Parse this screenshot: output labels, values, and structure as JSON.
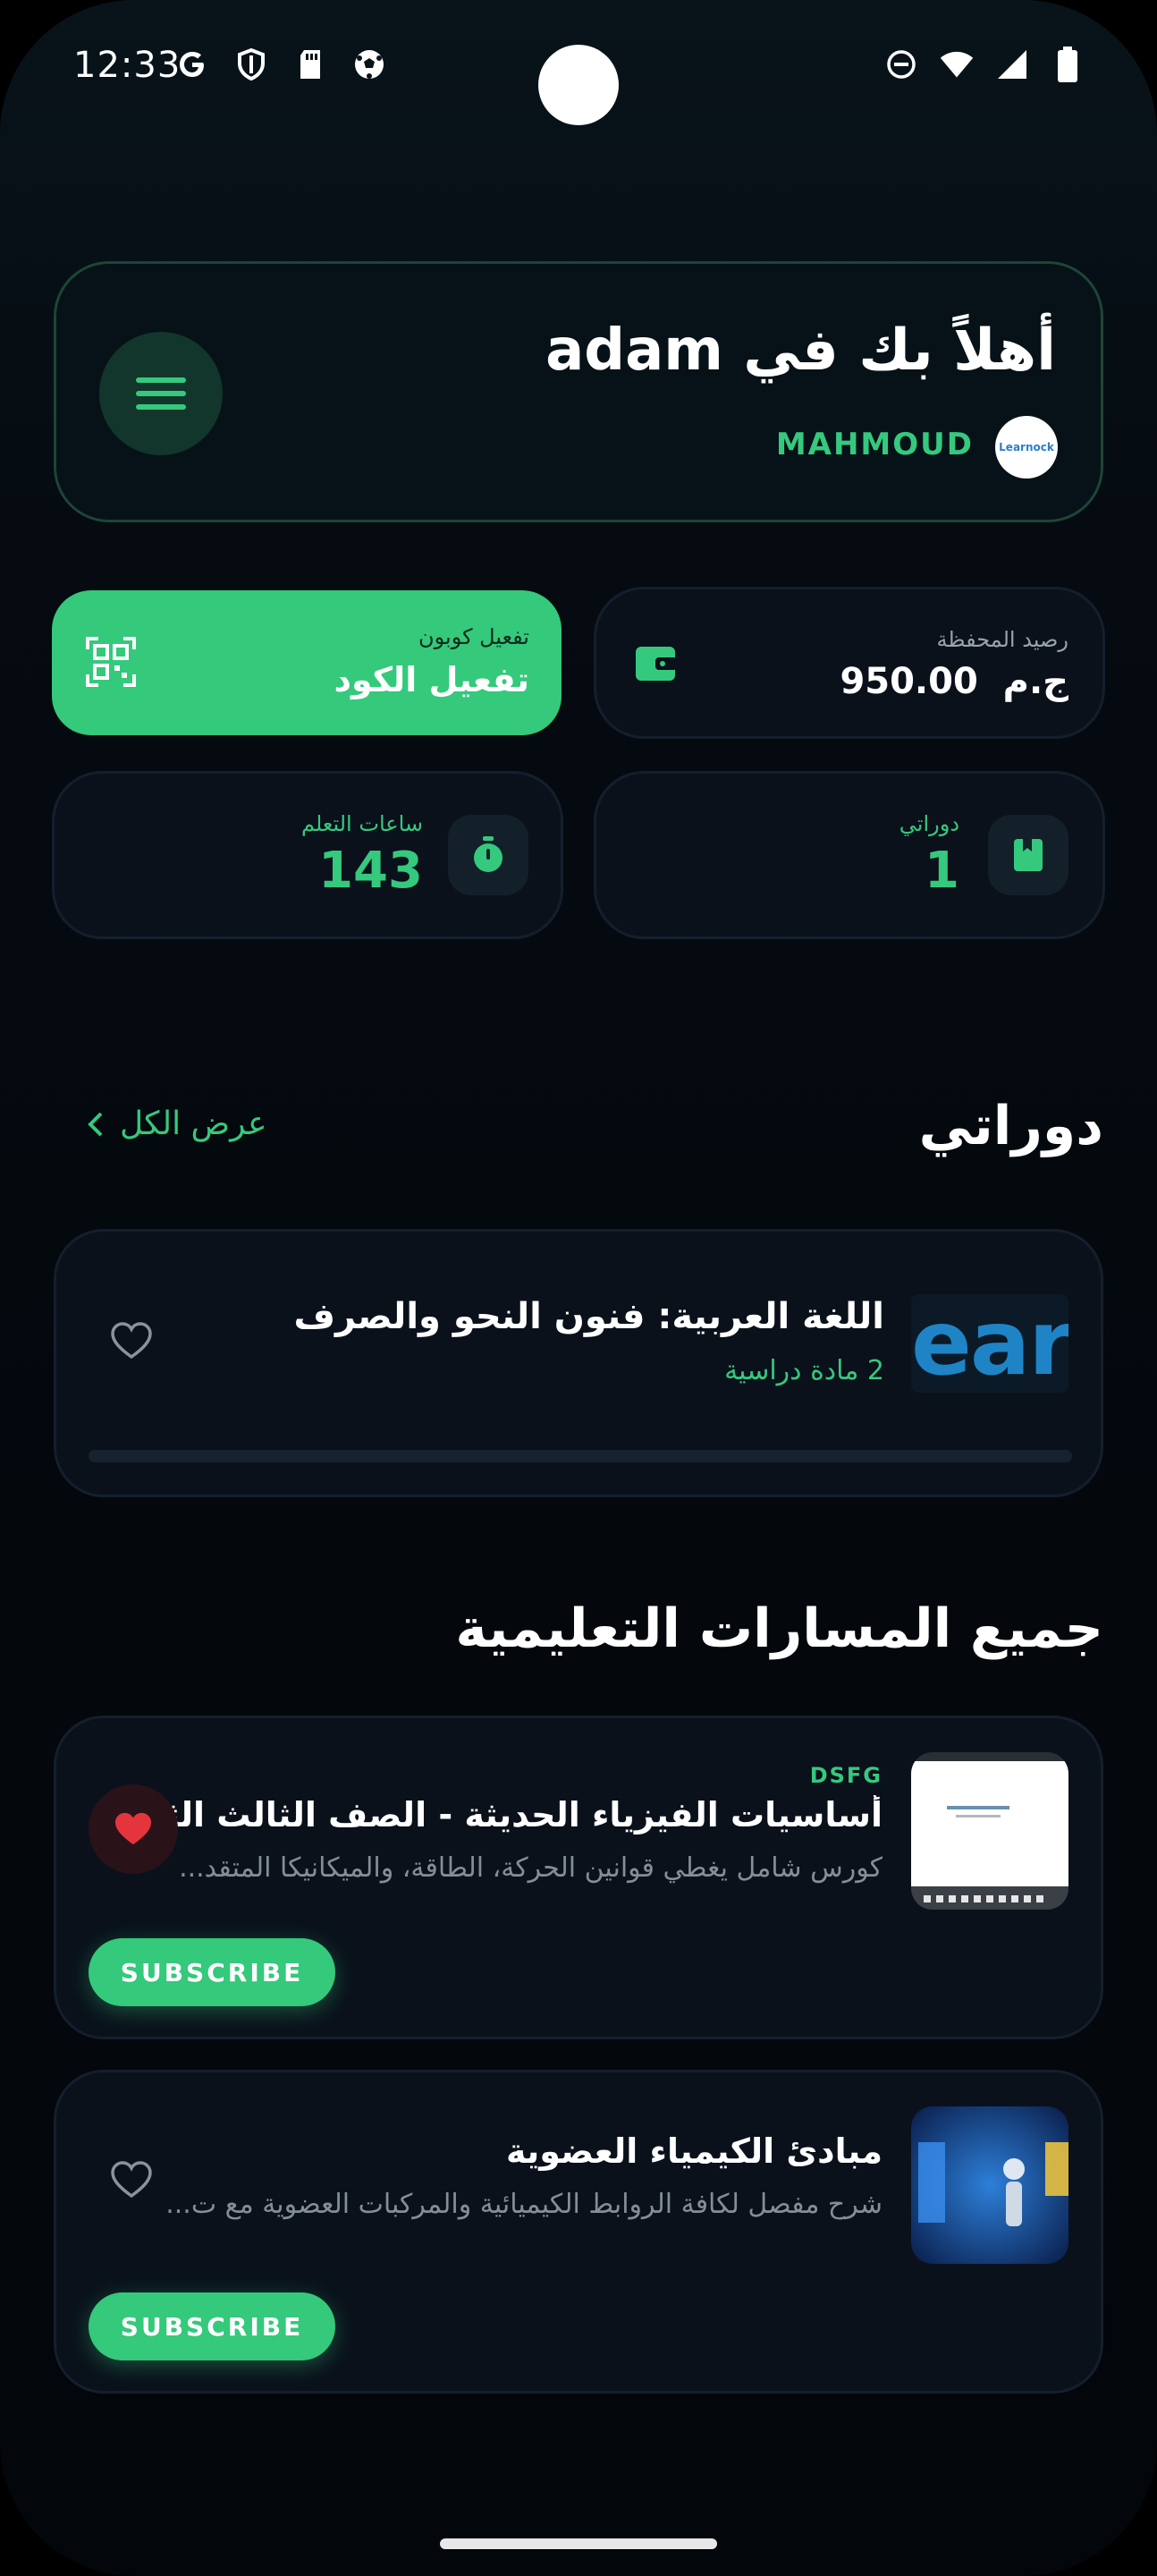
{
  "status_bar": {
    "time": "12:33",
    "left_icons": [
      "google-icon",
      "shield-icon",
      "sd-card-icon",
      "soccer-ball-icon"
    ],
    "right_icons": [
      "do-not-disturb-icon",
      "wifi-icon",
      "signal-icon",
      "battery-icon"
    ]
  },
  "header": {
    "greeting": "أهلاً بك في adam",
    "username": "MAHMOUD",
    "avatar_text": "Learnock"
  },
  "coupon": {
    "small_label": "تفعيل كوبون",
    "big_label": "تفعيل الكود"
  },
  "wallet": {
    "label": "رصيد المحفظة",
    "amount": "950.00",
    "currency": "ج.م"
  },
  "stats": {
    "courses_label": "دوراتي",
    "courses_value": "1",
    "hours_label": "ساعات التعلم",
    "hours_value": "143"
  },
  "my_courses": {
    "title": "دوراتي",
    "view_all": "عرض الكل",
    "course": {
      "thumb_text": "earr",
      "title": "اللغة العربية: فنون النحو والصرف",
      "subtitle": "2 مادة دراسية",
      "progress": 0
    }
  },
  "paths": {
    "title": "جميع المسارات التعليمية",
    "items": [
      {
        "tag": "DSFG",
        "title": "أساسيات الفيزياء الحديثة - الصف الثالث الثانو...",
        "description": "كورس شامل يغطي قوانين الحركة، الطاقة، والميكانيكا المتقد...",
        "favorited": true,
        "button": "SUBSCRIBE"
      },
      {
        "tag": "",
        "title": "مبادئ الكيمياء العضوية",
        "description": "شرح مفصل لكافة الروابط الكيميائية والمركبات العضوية مع ت...",
        "favorited": false,
        "button": "SUBSCRIBE"
      }
    ]
  },
  "colors": {
    "accent": "#34c97b",
    "background": "#04080d",
    "card": "#0a111b",
    "heart": "#e5353c"
  }
}
